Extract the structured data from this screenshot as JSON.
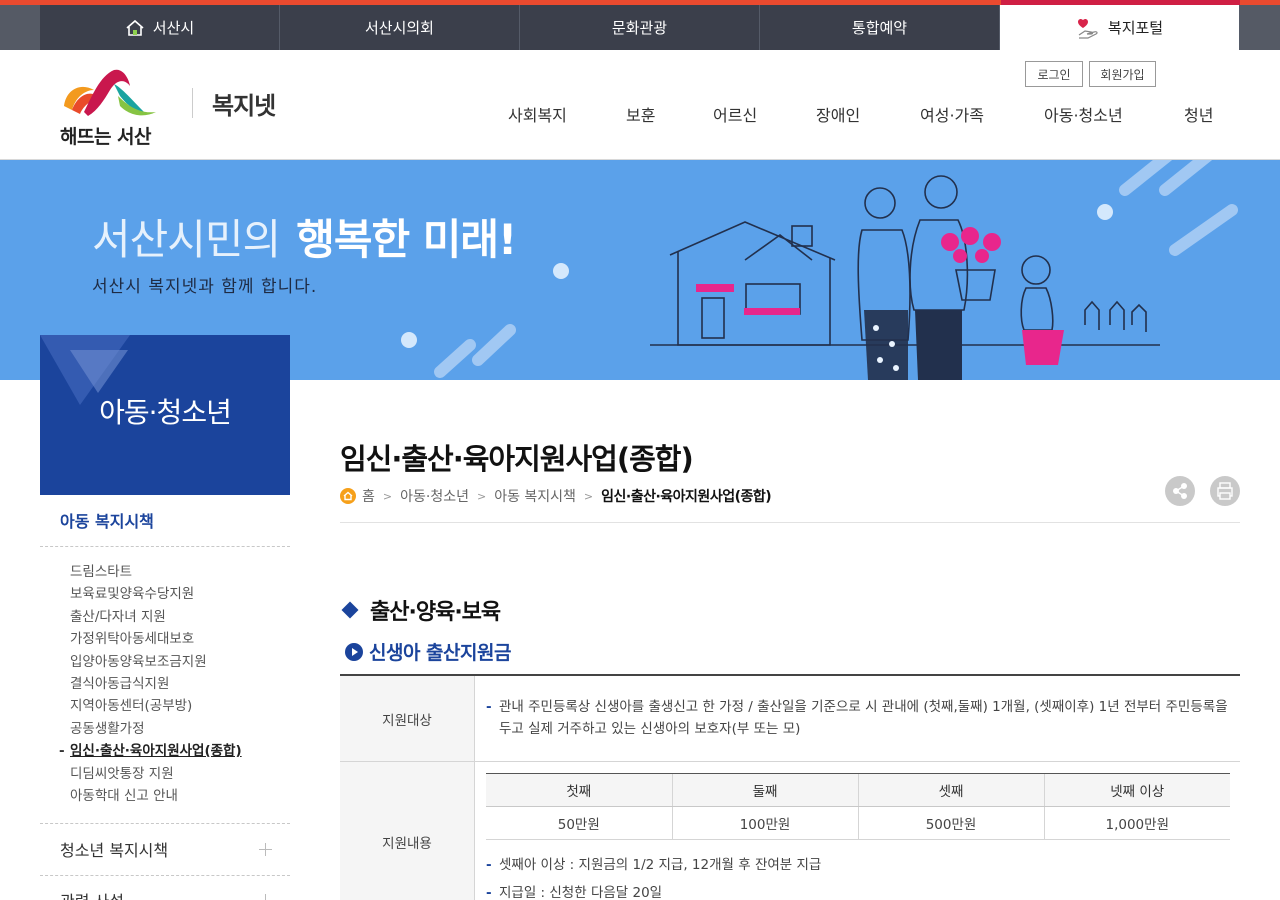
{
  "top_sites": [
    {
      "label": "서산시",
      "icon": "home-icon"
    },
    {
      "label": "서산시의회"
    },
    {
      "label": "문화관광"
    },
    {
      "label": "통합예약"
    },
    {
      "label": "복지포털",
      "icon": "heart-hand-icon",
      "active": true
    }
  ],
  "header": {
    "logo_text": "해뜨는 서산",
    "site_name": "복지넷",
    "login": "로그인",
    "join": "회원가입",
    "gnb": [
      "사회복지",
      "보훈",
      "어르신",
      "장애인",
      "여성·가족",
      "아동·청소년",
      "청년"
    ]
  },
  "banner": {
    "tagline_light": "서산시민의",
    "tagline_strong": "행복한 미래!",
    "sub": "서산시 복지넷과 함께 합니다."
  },
  "side": {
    "title": "아동·청소년",
    "section1": "아동 복지시책",
    "items": [
      "드림스타트",
      "보육료및양육수당지원",
      "출산/다자녀 지원",
      "가정위탁아동세대보호",
      "입양아동양육보조금지원",
      "결식아동급식지원",
      "지역아동센터(공부방)",
      "공동생활가정",
      "임신·출산·육아지원사업(종합)",
      "디딤씨앗통장 지원",
      "아동학대 신고 안내"
    ],
    "current_index": 8,
    "section2": "청소년 복지시책",
    "section3": "관련 사설"
  },
  "content": {
    "title": "임신·출산·육아지원사업(종합)",
    "breadcrumb": [
      "홈",
      "아동·청소년",
      "아동 복지시책",
      "임신·출산·육아지원사업(종합)"
    ],
    "h3": "출산·양육·보육",
    "h4": "신생아 출산지원금",
    "row1": {
      "th": "지원대상",
      "text": "관내 주민등록상 신생아를 출생신고 한 가정 / 출산일을 기준으로 시 관내에 (첫째,둘째) 1개월, (셋째이후) 1년 전부터 주민등록을 두고 실제 거주하고 있는 신생아의 보호자(부 또는 모)"
    },
    "row2": {
      "th": "지원내용",
      "table_headers": [
        "첫째",
        "둘째",
        "셋째",
        "넷째 이상"
      ],
      "table_values": [
        "50만원",
        "100만원",
        "500만원",
        "1,000만원"
      ],
      "notes": [
        "셋째아 이상 : 지원금의 1/2 지급, 12개월 후 잔여분 지급",
        "지급일 : 신청한 다음달 20일"
      ]
    }
  },
  "colors": {
    "top_red": "#ea4a2f",
    "portal_red": "#cf1f44",
    "banner_blue": "#5ba1ea",
    "brand_navy": "#1b449c",
    "home_orange": "#f6a01a"
  }
}
